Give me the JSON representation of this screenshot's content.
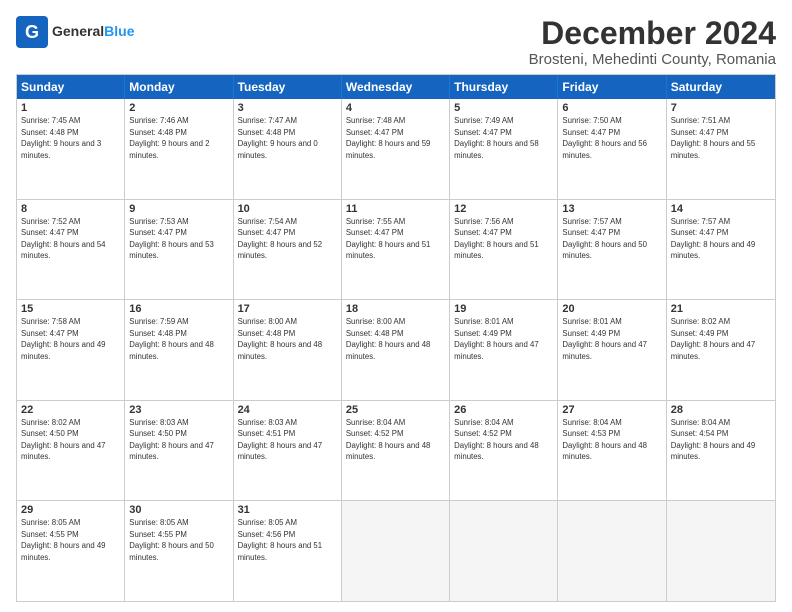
{
  "header": {
    "logo_general": "General",
    "logo_blue": "Blue",
    "month_title": "December 2024",
    "subtitle": "Brosteni, Mehedinti County, Romania"
  },
  "calendar": {
    "days": [
      "Sunday",
      "Monday",
      "Tuesday",
      "Wednesday",
      "Thursday",
      "Friday",
      "Saturday"
    ],
    "weeks": [
      [
        {
          "num": "1",
          "rise": "7:45 AM",
          "set": "4:48 PM",
          "daylight": "9 hours and 3 minutes."
        },
        {
          "num": "2",
          "rise": "7:46 AM",
          "set": "4:48 PM",
          "daylight": "9 hours and 2 minutes."
        },
        {
          "num": "3",
          "rise": "7:47 AM",
          "set": "4:48 PM",
          "daylight": "9 hours and 0 minutes."
        },
        {
          "num": "4",
          "rise": "7:48 AM",
          "set": "4:47 PM",
          "daylight": "8 hours and 59 minutes."
        },
        {
          "num": "5",
          "rise": "7:49 AM",
          "set": "4:47 PM",
          "daylight": "8 hours and 58 minutes."
        },
        {
          "num": "6",
          "rise": "7:50 AM",
          "set": "4:47 PM",
          "daylight": "8 hours and 56 minutes."
        },
        {
          "num": "7",
          "rise": "7:51 AM",
          "set": "4:47 PM",
          "daylight": "8 hours and 55 minutes."
        }
      ],
      [
        {
          "num": "8",
          "rise": "7:52 AM",
          "set": "4:47 PM",
          "daylight": "8 hours and 54 minutes."
        },
        {
          "num": "9",
          "rise": "7:53 AM",
          "set": "4:47 PM",
          "daylight": "8 hours and 53 minutes."
        },
        {
          "num": "10",
          "rise": "7:54 AM",
          "set": "4:47 PM",
          "daylight": "8 hours and 52 minutes."
        },
        {
          "num": "11",
          "rise": "7:55 AM",
          "set": "4:47 PM",
          "daylight": "8 hours and 51 minutes."
        },
        {
          "num": "12",
          "rise": "7:56 AM",
          "set": "4:47 PM",
          "daylight": "8 hours and 51 minutes."
        },
        {
          "num": "13",
          "rise": "7:57 AM",
          "set": "4:47 PM",
          "daylight": "8 hours and 50 minutes."
        },
        {
          "num": "14",
          "rise": "7:57 AM",
          "set": "4:47 PM",
          "daylight": "8 hours and 49 minutes."
        }
      ],
      [
        {
          "num": "15",
          "rise": "7:58 AM",
          "set": "4:47 PM",
          "daylight": "8 hours and 49 minutes."
        },
        {
          "num": "16",
          "rise": "7:59 AM",
          "set": "4:48 PM",
          "daylight": "8 hours and 48 minutes."
        },
        {
          "num": "17",
          "rise": "8:00 AM",
          "set": "4:48 PM",
          "daylight": "8 hours and 48 minutes."
        },
        {
          "num": "18",
          "rise": "8:00 AM",
          "set": "4:48 PM",
          "daylight": "8 hours and 48 minutes."
        },
        {
          "num": "19",
          "rise": "8:01 AM",
          "set": "4:49 PM",
          "daylight": "8 hours and 47 minutes."
        },
        {
          "num": "20",
          "rise": "8:01 AM",
          "set": "4:49 PM",
          "daylight": "8 hours and 47 minutes."
        },
        {
          "num": "21",
          "rise": "8:02 AM",
          "set": "4:49 PM",
          "daylight": "8 hours and 47 minutes."
        }
      ],
      [
        {
          "num": "22",
          "rise": "8:02 AM",
          "set": "4:50 PM",
          "daylight": "8 hours and 47 minutes."
        },
        {
          "num": "23",
          "rise": "8:03 AM",
          "set": "4:50 PM",
          "daylight": "8 hours and 47 minutes."
        },
        {
          "num": "24",
          "rise": "8:03 AM",
          "set": "4:51 PM",
          "daylight": "8 hours and 47 minutes."
        },
        {
          "num": "25",
          "rise": "8:04 AM",
          "set": "4:52 PM",
          "daylight": "8 hours and 48 minutes."
        },
        {
          "num": "26",
          "rise": "8:04 AM",
          "set": "4:52 PM",
          "daylight": "8 hours and 48 minutes."
        },
        {
          "num": "27",
          "rise": "8:04 AM",
          "set": "4:53 PM",
          "daylight": "8 hours and 48 minutes."
        },
        {
          "num": "28",
          "rise": "8:04 AM",
          "set": "4:54 PM",
          "daylight": "8 hours and 49 minutes."
        }
      ],
      [
        {
          "num": "29",
          "rise": "8:05 AM",
          "set": "4:55 PM",
          "daylight": "8 hours and 49 minutes."
        },
        {
          "num": "30",
          "rise": "8:05 AM",
          "set": "4:55 PM",
          "daylight": "8 hours and 50 minutes."
        },
        {
          "num": "31",
          "rise": "8:05 AM",
          "set": "4:56 PM",
          "daylight": "8 hours and 51 minutes."
        },
        null,
        null,
        null,
        null
      ]
    ]
  }
}
